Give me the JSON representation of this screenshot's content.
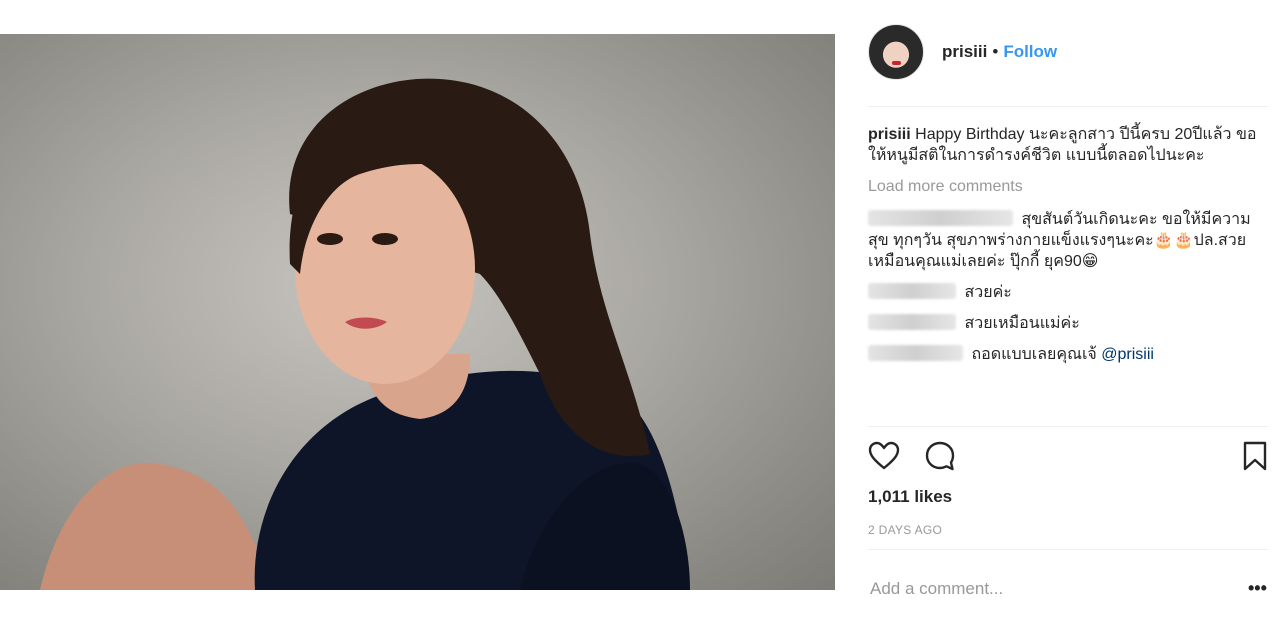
{
  "post": {
    "dots": [
      true,
      false,
      false
    ]
  },
  "header": {
    "username": "prisiii",
    "bullet": "•",
    "follow_label": "Follow"
  },
  "caption": {
    "username": "prisiii",
    "text": "Happy Birthday นะคะลูกสาว ปีนี้ครบ 20ปีแล้ว ขอให้หนูมีสติในการดำรงค์ชีวิต แบบนี้ตลอดไปนะคะ"
  },
  "load_more": "Load more comments",
  "comments": [
    {
      "text": "สุขสันต์วันเกิดนะคะ ขอให้มีความสุข ทุกๆวัน สุขภาพร่างกายแข็งแรงๆนะคะ🎂🎂ปล.สวยเหมือนคุณแม่เลยค่ะ ปุ๊กกี้ ยุค90😁"
    },
    {
      "text": "สวยค่ะ"
    },
    {
      "text": "สวยเหมือนแม่ค่ะ"
    },
    {
      "text": "ถอดแบบเลยคุณเจ้ ",
      "mention": "@prisiii"
    }
  ],
  "likes": "1,011 likes",
  "timestamp": "2 DAYS AGO",
  "add_comment_placeholder": "Add a comment...",
  "more_options": "•••",
  "icons": [
    "heart-icon",
    "comment-icon",
    "bookmark-icon"
  ],
  "colors": {
    "link": "#3897f0",
    "muted": "#999999",
    "text": "#262626"
  }
}
